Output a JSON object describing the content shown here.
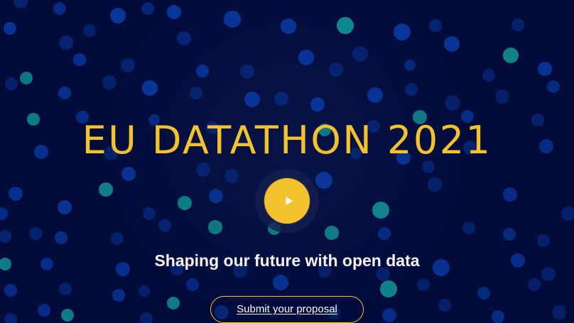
{
  "hero": {
    "title": "EU DATATHON 2021",
    "subtitle": "Shaping our future with open data",
    "cta_label": "Submit your proposal"
  },
  "icons": {
    "play": "play-icon"
  },
  "colors": {
    "background": "#020b3a",
    "accent": "#f4c22f",
    "text": "#ffffff",
    "dot_blue": "#0a3fa8",
    "dot_teal": "#139c98"
  }
}
